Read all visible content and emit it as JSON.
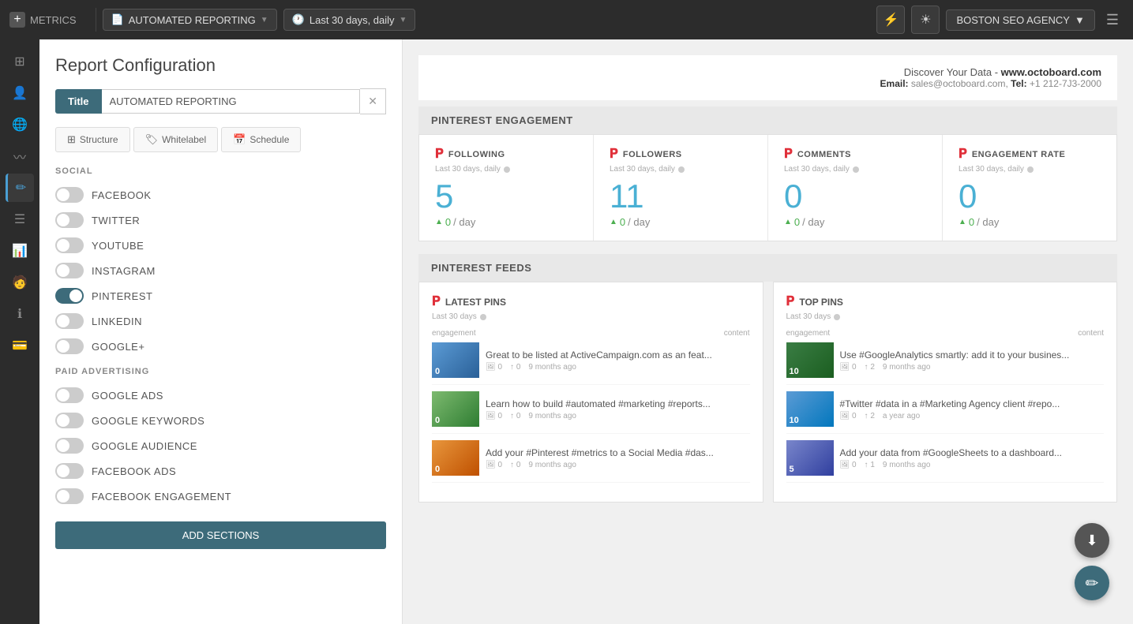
{
  "topnav": {
    "brand": "METRICS",
    "report_label": "AUTOMATED REPORTING",
    "date_range": "Last 30 days, daily",
    "agency": "BOSTON SEO AGENCY"
  },
  "left_panel": {
    "title": "Report Configuration",
    "title_field_label": "Title",
    "title_field_value": "AUTOMATED REPORTING",
    "tabs": [
      {
        "id": "structure",
        "label": "Structure"
      },
      {
        "id": "whitelabel",
        "label": "Whitelabel"
      },
      {
        "id": "schedule",
        "label": "Schedule"
      }
    ],
    "social_header": "SOCIAL",
    "social_items": [
      {
        "label": "FACEBOOK",
        "on": false
      },
      {
        "label": "TWITTER",
        "on": false
      },
      {
        "label": "YOUTUBE",
        "on": false
      },
      {
        "label": "INSTAGRAM",
        "on": false
      },
      {
        "label": "PINTEREST",
        "on": true
      },
      {
        "label": "LINKEDIN",
        "on": false
      },
      {
        "label": "GOOGLE+",
        "on": false
      }
    ],
    "paid_header": "PAID ADVERTISING",
    "paid_items": [
      {
        "label": "GOOGLE ADS",
        "on": false
      },
      {
        "label": "GOOGLE KEYWORDS",
        "on": false
      },
      {
        "label": "GOOGLE AUDIENCE",
        "on": false
      },
      {
        "label": "FACEBOOK ADS",
        "on": false
      },
      {
        "label": "FACEBOOK ENGAGEMENT",
        "on": false
      }
    ],
    "add_btn": "ADD SECTIONS"
  },
  "report": {
    "header": {
      "title": "Discover Your Data - www.octoboard.com",
      "email_label": "Email:",
      "email": "sales@octoboard.com",
      "tel_label": "Tel:",
      "tel": "+1 212-7J3-2000"
    },
    "pinterest_engagement": {
      "section_title": "PINTEREST ENGAGEMENT",
      "metrics": [
        {
          "name": "FOLLOWING",
          "sub": "Last 30 days, daily",
          "value": "5",
          "delta": "0",
          "unit": "/ day"
        },
        {
          "name": "FOLLOWERS",
          "sub": "Last 30 days, daily",
          "value": "11",
          "delta": "0",
          "unit": "/ day"
        },
        {
          "name": "COMMENTS",
          "sub": "Last 30 days, daily",
          "value": "0",
          "delta": "0",
          "unit": "/ day"
        },
        {
          "name": "ENGAGEMENT RATE",
          "sub": "Last 30 days, daily",
          "value": "0",
          "delta": "0",
          "unit": "/ day"
        }
      ]
    },
    "pinterest_feeds": {
      "section_title": "PINTEREST FEEDS",
      "latest_pins": {
        "title": "LATEST PINS",
        "sub": "Last 30 days",
        "col_engagement": "engagement",
        "col_content": "content",
        "items": [
          {
            "thumb_class": "thumb-blue",
            "num": "0",
            "text": "Great to be listed at ActiveCampaign.com as an feat...",
            "likes": "0",
            "repins": "0",
            "time": "9 months ago"
          },
          {
            "thumb_class": "thumb-green",
            "num": "0",
            "text": "Learn how to build #automated #marketing #reports...",
            "likes": "0",
            "repins": "0",
            "time": "9 months ago"
          },
          {
            "thumb_class": "thumb-orange",
            "num": "0",
            "text": "Add your #Pinterest #metrics to a Social Media #das...",
            "likes": "0",
            "repins": "0",
            "time": "9 months ago"
          }
        ]
      },
      "top_pins": {
        "title": "TOP PINS",
        "sub": "Last 30 days",
        "col_engagement": "engagement",
        "col_content": "content",
        "items": [
          {
            "thumb_class": "thumb-forest",
            "num": "10",
            "text": "Use #GoogleAnalytics smartly: add it to your busines...",
            "likes": "0",
            "repins": "2",
            "time": "9 months ago"
          },
          {
            "thumb_class": "thumb-sky",
            "num": "10",
            "text": "#Twitter #data in a #Marketing Agency client #repo...",
            "likes": "0",
            "repins": "2",
            "time": "a year ago"
          },
          {
            "thumb_class": "thumb-chart",
            "num": "5",
            "text": "Add your data from #GoogleSheets to a dashboard...",
            "likes": "0",
            "repins": "1",
            "time": "9 months ago"
          }
        ]
      }
    }
  },
  "left_icons": [
    {
      "id": "dashboard",
      "symbol": "⊞"
    },
    {
      "id": "users",
      "symbol": "👤"
    },
    {
      "id": "globe",
      "symbol": "🌐"
    },
    {
      "id": "analytics",
      "symbol": "〰"
    },
    {
      "id": "edit",
      "symbol": "✏"
    },
    {
      "id": "list",
      "symbol": "☰"
    },
    {
      "id": "chart",
      "symbol": "📊"
    },
    {
      "id": "person",
      "symbol": "🧑"
    },
    {
      "id": "info",
      "symbol": "ℹ"
    },
    {
      "id": "billing",
      "symbol": "💳"
    }
  ]
}
